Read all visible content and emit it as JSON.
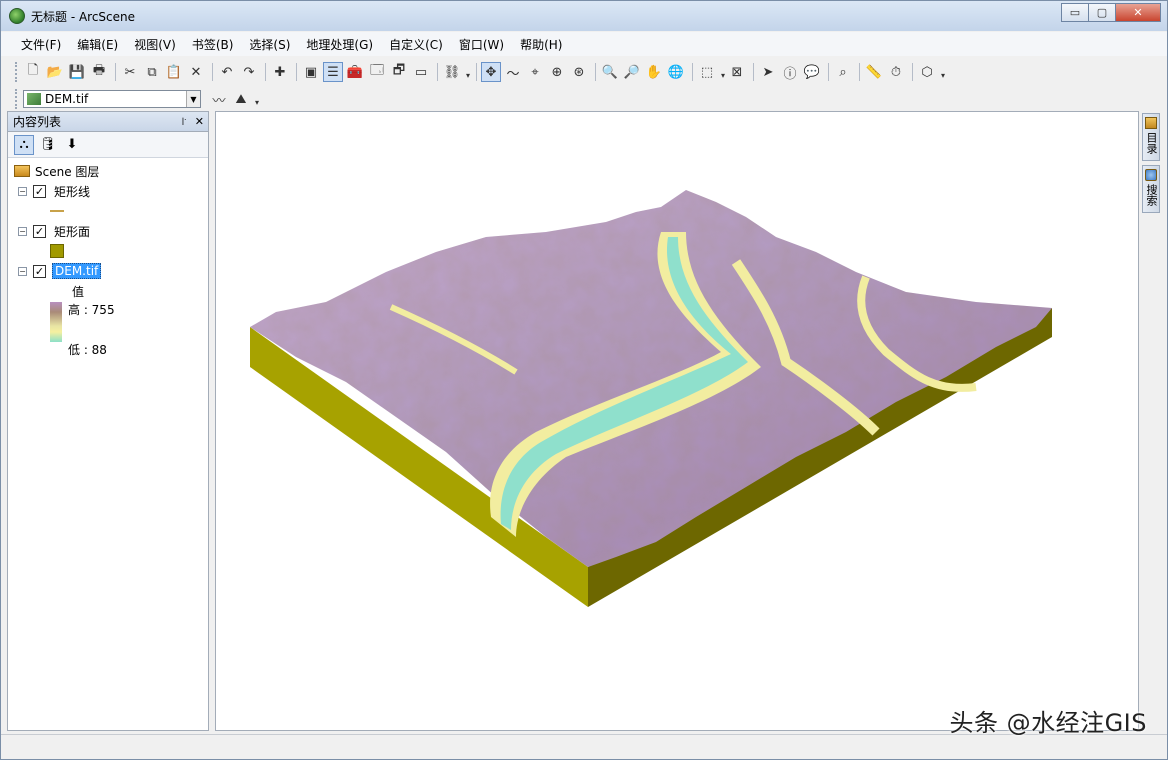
{
  "window": {
    "title": "无标题 - ArcScene",
    "minimize_glyph": "▭",
    "maximize_glyph": "▢",
    "close_glyph": "✕"
  },
  "menu": [
    "文件(F)",
    "编辑(E)",
    "视图(V)",
    "书签(B)",
    "选择(S)",
    "地理处理(G)",
    "自定义(C)",
    "窗口(W)",
    "帮助(H)"
  ],
  "layer_dropdown": {
    "value": "DEM.tif"
  },
  "toc": {
    "title": "内容列表",
    "pin_glyph": "꜎",
    "close_glyph": "✕",
    "root": "Scene 图层",
    "layers": [
      {
        "name": "矩形线",
        "checked": true
      },
      {
        "name": "矩形面",
        "checked": true
      },
      {
        "name": "DEM.tif",
        "checked": true,
        "selected": true
      }
    ],
    "dem_legend": {
      "value_label": "值",
      "high": "高 : 755",
      "low": "低 : 88"
    },
    "colors": {
      "line_symbol": "#c8a24a",
      "poly_symbol": "#a19a00"
    }
  },
  "side_tabs": [
    "目录",
    "搜索"
  ],
  "watermark": "头条 @水经注GIS",
  "scene": {
    "colors": {
      "base_front": "#a7a200",
      "base_right": "#6d6700",
      "high": "#b79bc3",
      "mid": "#9c7a4e",
      "low_mid": "#f2eda0",
      "water": "#8fe0cc"
    }
  }
}
